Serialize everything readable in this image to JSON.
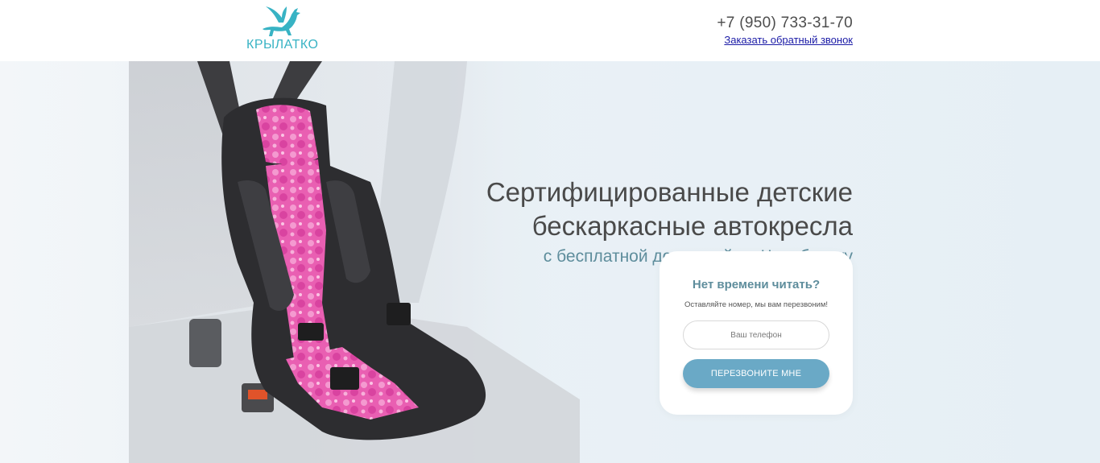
{
  "header": {
    "logo_text": "КРЫЛАТКО",
    "phone": "+7 (950) 733-31-70",
    "callback_link": "Заказать обратный звонок"
  },
  "hero": {
    "title": "Сертифицированные детские бескаркасные автокресла",
    "subtitle": "с бесплатной доставкой по Челябинску",
    "image_name": "child-car-seat-photo"
  },
  "form": {
    "title": "Нет времени читать?",
    "note": "Оставляйте номер, мы вам перезвоним!",
    "phone_placeholder": "Ваш телефон",
    "phone_value": "",
    "submit_label": "ПЕРЕЗВОНИТЕ МНЕ"
  },
  "colors": {
    "accent": "#6aa9c6",
    "logo": "#38b3c4",
    "subtitle": "#5e8d9c",
    "hero_bg": "#e8f1f6"
  }
}
